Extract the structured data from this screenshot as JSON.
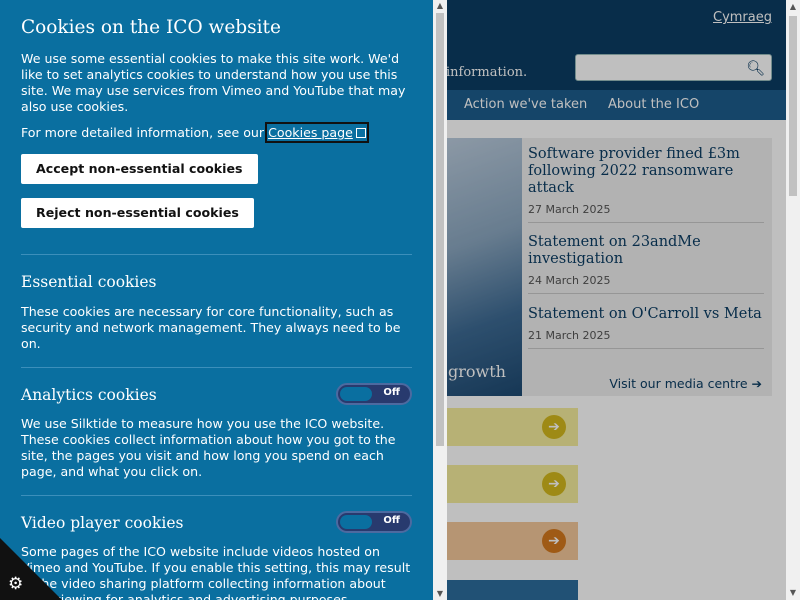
{
  "site": {
    "cymraeg": "Cymraeg",
    "tagline": "information.",
    "nav": [
      "Action we've taken",
      "About the ICO"
    ],
    "hero_text": "growth",
    "news": [
      {
        "title": "Software provider fined £3m following 2022 ransomware attack",
        "date": "27 March 2025"
      },
      {
        "title": "Statement on 23andMe investigation",
        "date": "24 March 2025"
      },
      {
        "title": "Statement on O'Carroll vs Meta",
        "date": "21 March 2025"
      }
    ],
    "media_link": "Visit our media centre ➔",
    "colors": {
      "header": "#0b3d63",
      "nav": "#1d5c8c",
      "card_yellow": "#f5ed9d",
      "card_orange": "#f3c79a"
    }
  },
  "cookie_panel": {
    "title": "Cookies on the ICO website",
    "intro": "We use some essential cookies to make this site work. We'd like to set analytics cookies to understand how you use this site. We may use services from Vimeo and YouTube that may also use cookies.",
    "more_info_prefix": "For more detailed information, see our ",
    "cookies_page_link": "Cookies page",
    "accept_button": "Accept non-essential cookies",
    "reject_button": "Reject non-essential cookies",
    "sections": [
      {
        "heading": "Essential cookies",
        "text": "These cookies are necessary for core functionality, such as security and network management. They always need to be on."
      },
      {
        "heading": "Analytics cookies",
        "toggle": "Off",
        "text": "We use Silktide to measure how you use the ICO website. These cookies collect information about how you got to the site, the pages you visit and how long you spend on each page, and what you click on."
      },
      {
        "heading": "Video player cookies",
        "toggle": "Off",
        "text": "Some pages of the ICO website include videos hosted on Vimeo and YouTube. If you enable this setting, this may result in the video sharing platform collecting information about your viewing for analytics and advertising purposes."
      }
    ],
    "color": "#0a6fa0"
  },
  "icons": {
    "search": "search-icon",
    "external": "external-link-icon",
    "cookie": "cookie-settings-icon"
  }
}
